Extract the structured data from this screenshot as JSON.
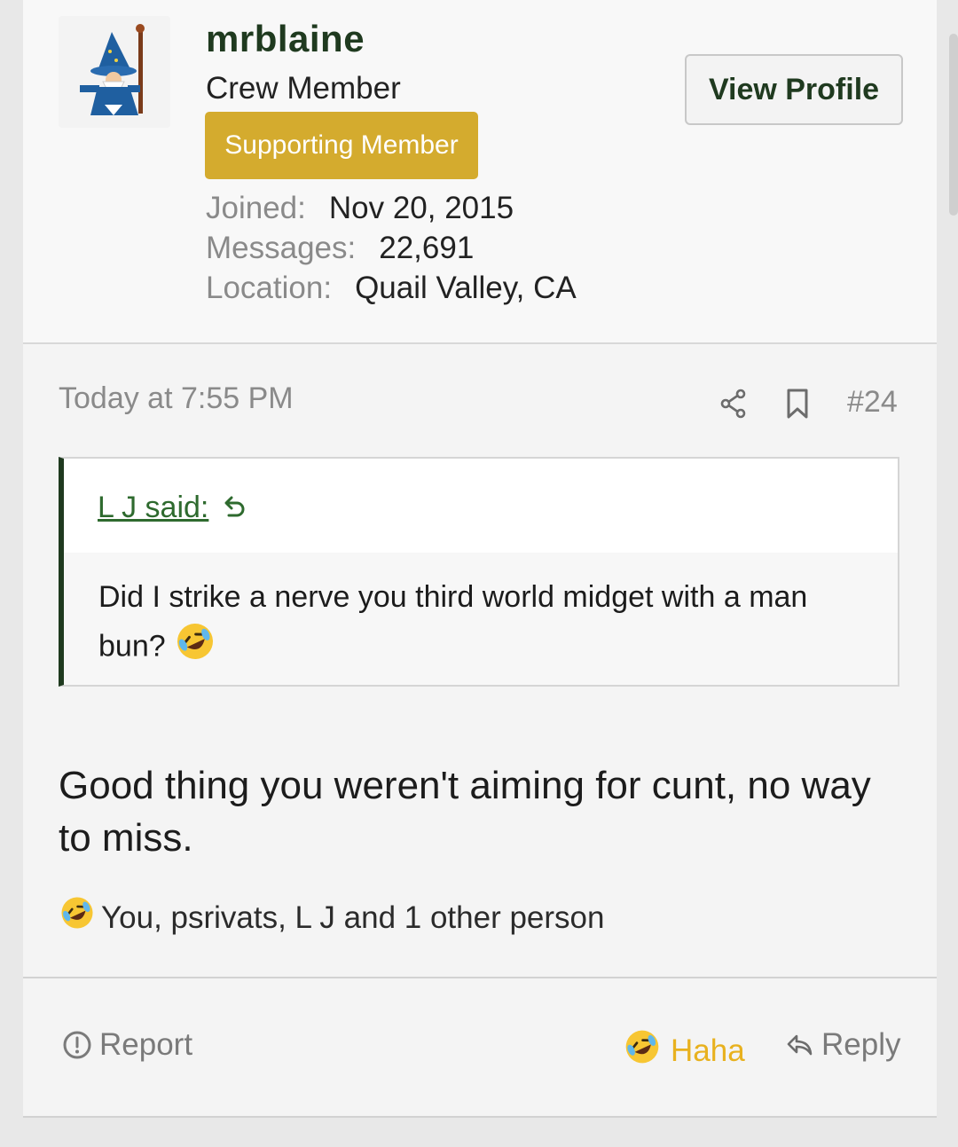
{
  "user": {
    "username": "mrblaine",
    "title": "Crew Member",
    "badge": "Supporting Member",
    "view_profile_label": "View Profile",
    "stats": [
      {
        "key": "Joined:",
        "value": "Nov 20, 2015"
      },
      {
        "key": "Messages:",
        "value": "22,691"
      },
      {
        "key": "Location:",
        "value": "Quail Valley, CA"
      }
    ],
    "avatar_icon": "wizard-avatar-icon"
  },
  "post": {
    "timestamp": "Today at 7:55 PM",
    "number": "#24",
    "quote": {
      "author": "L J said:",
      "text": "Did I strike a nerve you third world midget with a man bun?"
    },
    "message": "Good thing you weren't aiming for cunt, no way to miss.",
    "reactions_summary": "You, psrivats, L J and 1 other person"
  },
  "actions": {
    "report_label": "Report",
    "haha_label": "Haha",
    "reply_label": "Reply"
  },
  "colors": {
    "accent_green": "#1f3a1f",
    "badge_gold": "#d4ab2e",
    "haha_yellow": "#e8b11e"
  }
}
